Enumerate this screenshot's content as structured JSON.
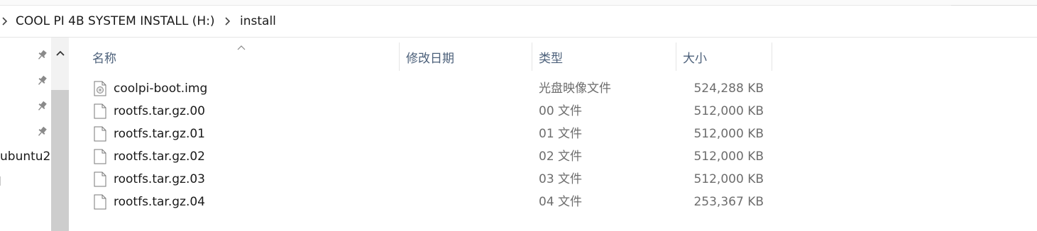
{
  "breadcrumb": {
    "items": [
      {
        "label": "COOL PI 4B SYSTEM INSTALL (H:)"
      },
      {
        "label": "install"
      }
    ]
  },
  "nav": {
    "items": [
      "ubuntu2",
      "d"
    ]
  },
  "columns": {
    "name": "名称",
    "modified": "修改日期",
    "type": "类型",
    "size": "大小"
  },
  "files": [
    {
      "name": "coolpi-boot.img",
      "modified": "",
      "type": "光盘映像文件",
      "size": "524,288 KB",
      "icon": "disc-image-icon"
    },
    {
      "name": "rootfs.tar.gz.00",
      "modified": "",
      "type": "00 文件",
      "size": "512,000 KB",
      "icon": "file-icon"
    },
    {
      "name": "rootfs.tar.gz.01",
      "modified": "",
      "type": "01 文件",
      "size": "512,000 KB",
      "icon": "file-icon"
    },
    {
      "name": "rootfs.tar.gz.02",
      "modified": "",
      "type": "02 文件",
      "size": "512,000 KB",
      "icon": "file-icon"
    },
    {
      "name": "rootfs.tar.gz.03",
      "modified": "",
      "type": "03 文件",
      "size": "512,000 KB",
      "icon": "file-icon"
    },
    {
      "name": "rootfs.tar.gz.04",
      "modified": "",
      "type": "04 文件",
      "size": "253,367 KB",
      "icon": "file-icon"
    }
  ]
}
